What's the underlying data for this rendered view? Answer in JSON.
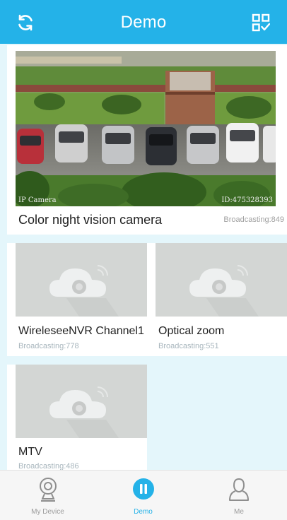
{
  "app": {
    "title": "Demo"
  },
  "featured": {
    "name": "Color night vision camera",
    "broadcast": "Broadcasting:849",
    "overlay_left": "IP Camera",
    "overlay_right": "ID:475328393"
  },
  "cameras": [
    {
      "name": "WireleseeNVR Channel1",
      "broadcast": "Broadcasting:778"
    },
    {
      "name": "Optical zoom",
      "broadcast": "Broadcasting:551"
    },
    {
      "name": "MTV",
      "broadcast": "Broadcasting:486"
    }
  ],
  "nav": [
    {
      "label": "My Device",
      "icon": "webcam-icon"
    },
    {
      "label": "Demo",
      "icon": "pause-icon"
    },
    {
      "label": "Me",
      "icon": "person-icon"
    }
  ],
  "colors": {
    "header": "#24b2e8",
    "page_background": "#e4f6fb",
    "placeholder": "#d3d6d4",
    "active_nav": "#24b2e8",
    "inactive_nav": "#9c9c9c"
  }
}
